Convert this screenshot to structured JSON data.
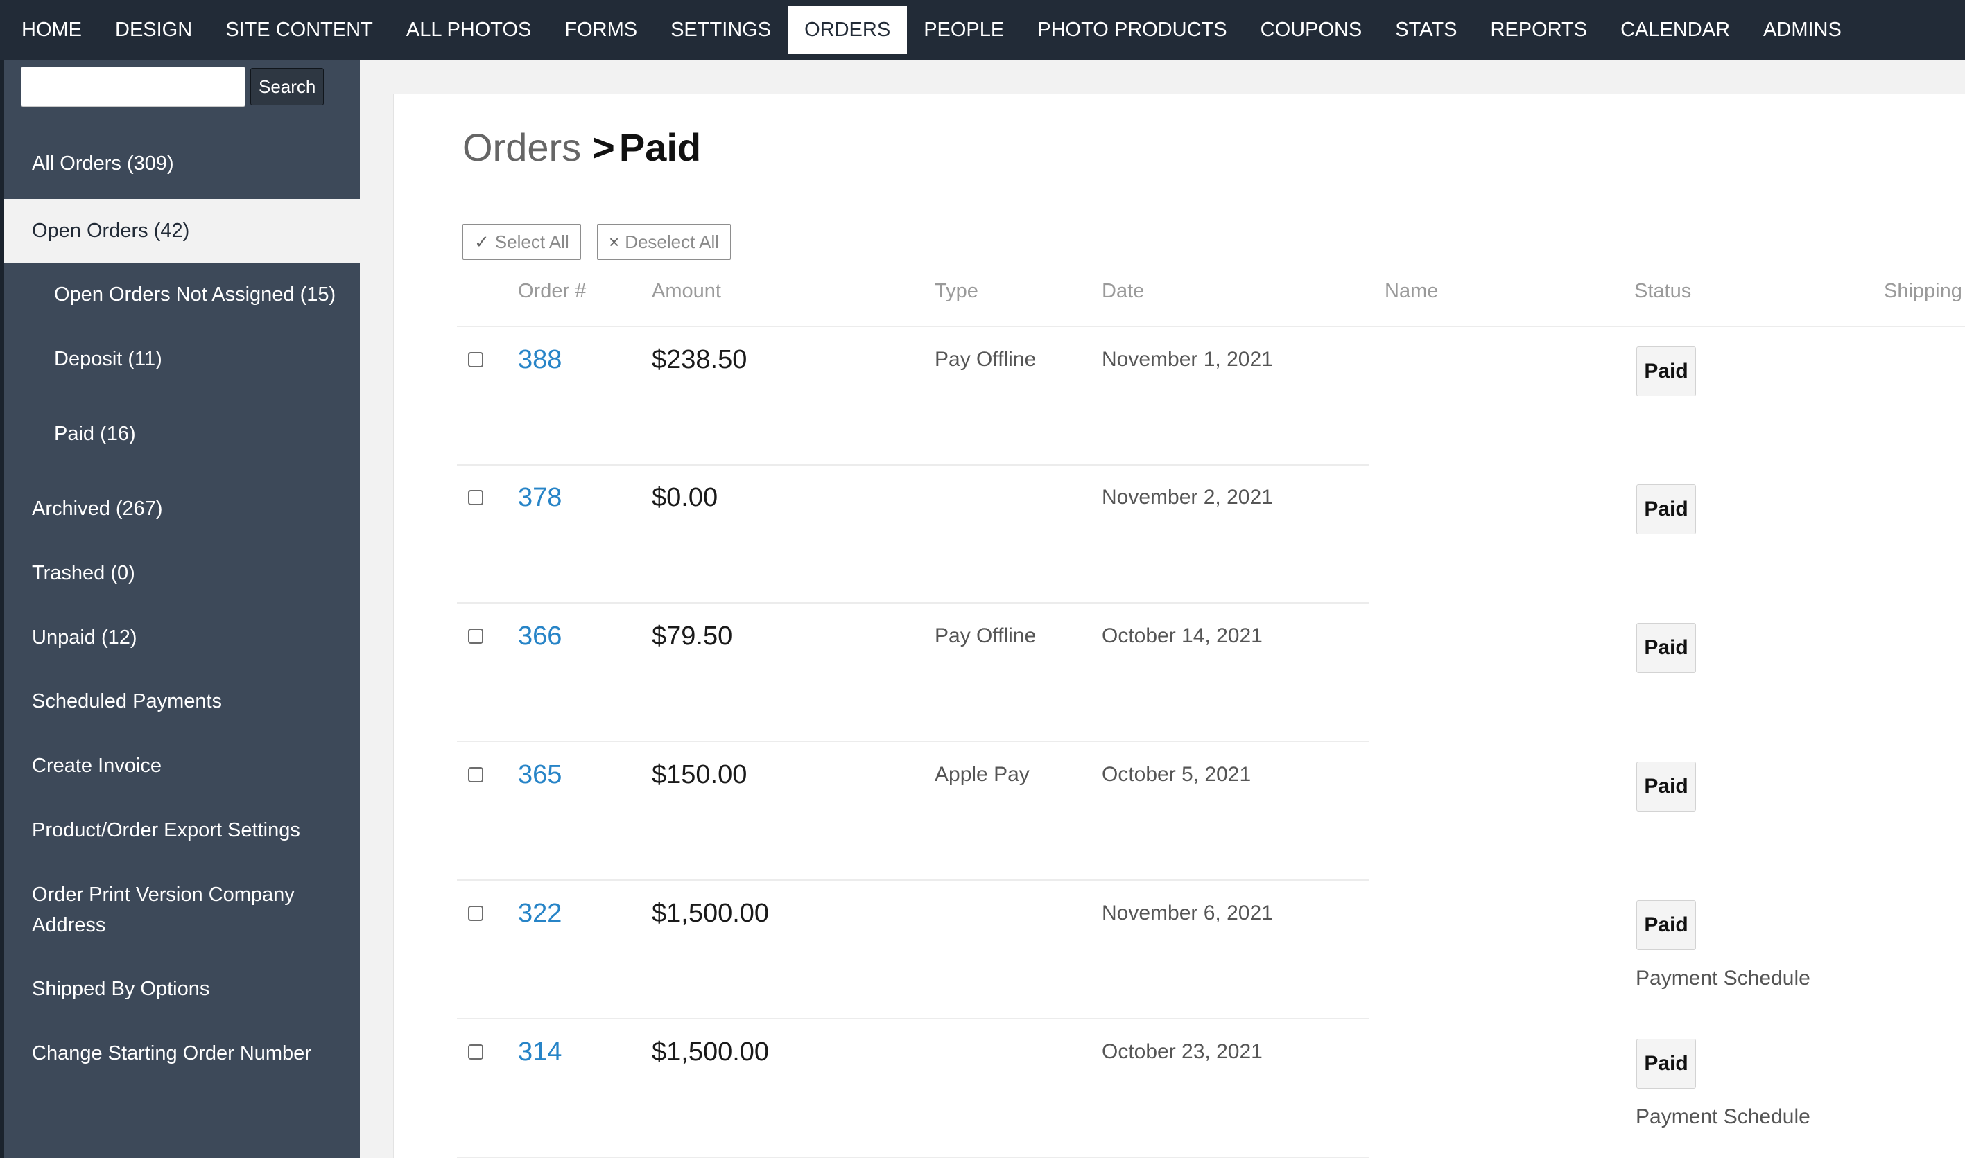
{
  "topnav": {
    "items": [
      "HOME",
      "DESIGN",
      "SITE CONTENT",
      "ALL PHOTOS",
      "FORMS",
      "SETTINGS",
      "ORDERS",
      "PEOPLE",
      "PHOTO PRODUCTS",
      "COUPONS",
      "STATS",
      "REPORTS",
      "CALENDAR",
      "ADMINS"
    ],
    "active": "ORDERS"
  },
  "sidebar": {
    "search": {
      "value": "",
      "placeholder": "",
      "button_label": "Search"
    },
    "items": [
      {
        "label": "All Orders (309)"
      },
      {
        "label": "Open Orders (42)"
      },
      {
        "label": "Open Orders Not Assigned (15)"
      },
      {
        "label": "Deposit (11)"
      },
      {
        "label": "Paid (16)"
      },
      {
        "label": "Archived (267)"
      },
      {
        "label": "Trashed (0)"
      },
      {
        "label": "Unpaid (12)"
      },
      {
        "label": "Scheduled Payments"
      },
      {
        "label": "Create Invoice"
      },
      {
        "label": "Product/Order Export Settings"
      },
      {
        "label": "Order Print Version Company Address"
      },
      {
        "label": "Shipped By Options"
      },
      {
        "label": "Change Starting Order Number"
      }
    ]
  },
  "main": {
    "breadcrumb": {
      "parent": "Orders",
      "separator": ">",
      "current": "Paid"
    },
    "select_all_icon": "✓",
    "select_all_label": "Select All",
    "deselect_all_icon": "×",
    "deselect_all_label": "Deselect All",
    "columns": [
      "Order #",
      "Amount",
      "Type",
      "Date",
      "Name",
      "Status",
      "Shipping"
    ],
    "rows": [
      {
        "order": "388",
        "amount": "$238.50",
        "type": "Pay Offline",
        "date": "November 1, 2021",
        "name": "",
        "status": "Paid",
        "note": ""
      },
      {
        "order": "378",
        "amount": "$0.00",
        "type": "",
        "date": "November 2, 2021",
        "name": "",
        "status": "Paid",
        "note": ""
      },
      {
        "order": "366",
        "amount": "$79.50",
        "type": "Pay Offline",
        "date": "October 14, 2021",
        "name": "",
        "status": "Paid",
        "note": ""
      },
      {
        "order": "365",
        "amount": "$150.00",
        "type": "Apple Pay",
        "date": "October 5, 2021",
        "name": "",
        "status": "Paid",
        "note": ""
      },
      {
        "order": "322",
        "amount": "$1,500.00",
        "type": "",
        "date": "November 6, 2021",
        "name": "",
        "status": "Paid",
        "note": "Payment Schedule"
      },
      {
        "order": "314",
        "amount": "$1,500.00",
        "type": "",
        "date": "October 23, 2021",
        "name": "",
        "status": "Paid",
        "note": "Payment Schedule"
      }
    ]
  },
  "colors": {
    "nav_bg": "#222b37",
    "sidebar_bg": "#3d4959",
    "link": "#2784c7",
    "page_bg": "#f2f2f2"
  }
}
